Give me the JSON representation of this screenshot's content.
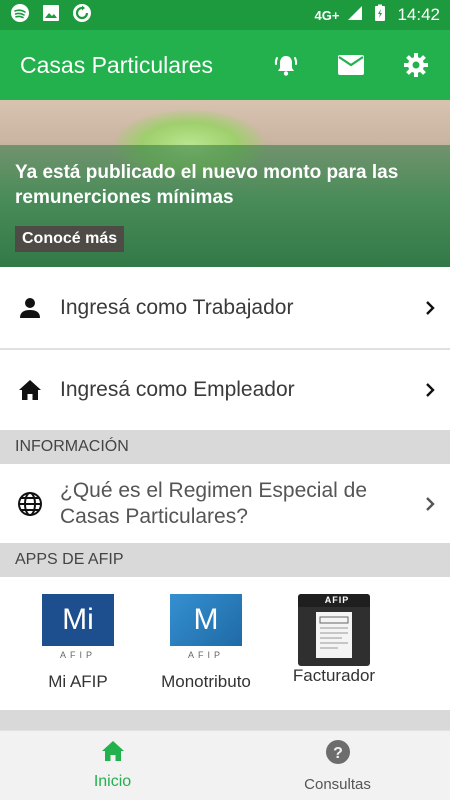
{
  "status_bar": {
    "network": "4G+",
    "time": "14:42",
    "icons": [
      "spotify-icon",
      "image-icon",
      "sync-icon",
      "signal-icon",
      "battery-charging-icon"
    ]
  },
  "app_bar": {
    "title": "Casas Particulares",
    "actions": [
      "alarm-bell-icon",
      "mail-icon",
      "settings-gear-icon"
    ]
  },
  "banner": {
    "title": "Ya está publicado el nuevo monto para las remunerciones mínimas",
    "button": "Conocé más"
  },
  "login": {
    "worker": "Ingresá como Trabajador",
    "employer": "Ingresá como Empleador"
  },
  "info_section": {
    "header": "INFORMACIÓN",
    "item": "¿Qué es el Regimen Especial de Casas Particulares?"
  },
  "apps_section": {
    "header": "APPS DE AFIP",
    "apps": [
      {
        "label": "Mi AFIP",
        "logo_text": "Mi",
        "logo_sub": "AFIP"
      },
      {
        "label": "Monotributo",
        "logo_text": "M",
        "logo_sub": "AFIP"
      },
      {
        "label": "Facturador",
        "logo_text": "AFIP"
      }
    ]
  },
  "bottom_nav": {
    "home": "Inicio",
    "queries": "Consultas"
  },
  "colors": {
    "status_bar": "#1e9a3e",
    "app_bar": "#22b14c",
    "active_nav": "#22b14c",
    "mi_afip_logo": "#1d4f8f",
    "monotributo_logo": "#2a7fbf"
  }
}
